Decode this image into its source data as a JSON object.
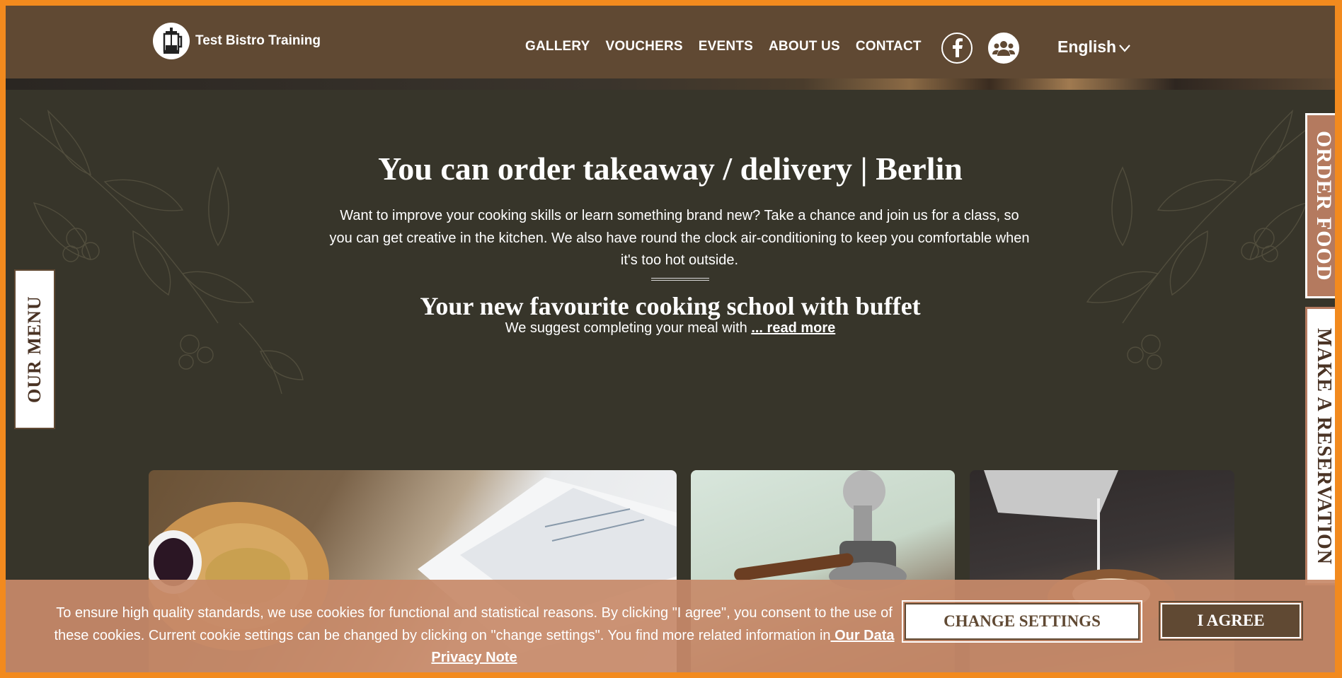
{
  "header": {
    "logo_text": "Test Bistro Training",
    "nav": [
      "GALLERY",
      "VOUCHERS",
      "EVENTS",
      "ABOUT US",
      "CONTACT"
    ],
    "language": "English"
  },
  "hero": {
    "title": "You can order takeaway / delivery | Berlin",
    "intro": "Want to improve your cooking skills or learn something brand new? Take a chance and join us for a class, so you can get creative in the kitchen. We also have round the clock air-conditioning to keep you comfortable when it's too hot outside.",
    "subtitle": "Your new favourite cooking school with buffet",
    "suggest_text": "We suggest completing your meal with ",
    "read_more": "... read more"
  },
  "side_tabs": {
    "menu": "OUR MENU",
    "order": "ORDER FOOD",
    "reservation": "MAKE A RESERVATION"
  },
  "cookie": {
    "text": "To ensure high quality standards, we use cookies for functional and statistical reasons. By clicking \"I agree\", you consent to the use of these cookies. Current cookie settings can be changed by clicking on \"change settings\". You find more related information in",
    "privacy_link": " Our Data Privacy Note",
    "change_settings": "CHANGE SETTINGS",
    "agree": "I AGREE"
  },
  "icons": [
    "french-press-logo-icon",
    "facebook-icon",
    "group-icon",
    "chevron-down-icon"
  ]
}
